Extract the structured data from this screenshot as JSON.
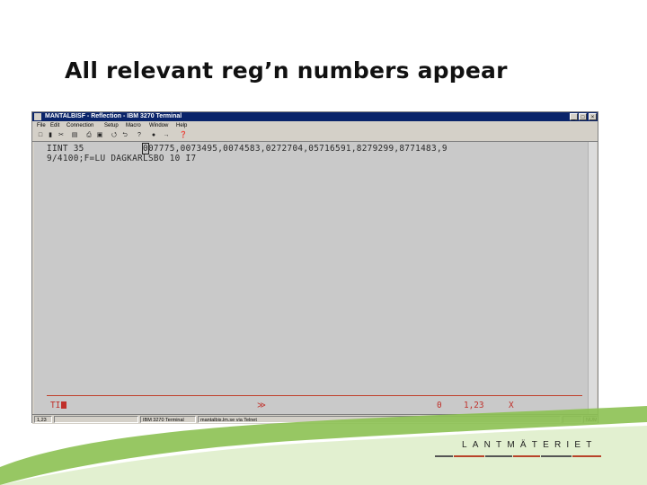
{
  "slide": {
    "title": "All relevant reg’n numbers appear"
  },
  "window": {
    "title": "MANTALBISF - Reflection - IBM 3270 Terminal",
    "controls": [
      "_",
      "□",
      "×"
    ]
  },
  "menu": [
    "File",
    "Edit",
    "Connection",
    "Setup",
    "Macro",
    "Window",
    "Help"
  ],
  "toolbar": [
    "□",
    "▮",
    "✂",
    "▤",
    "⎙",
    "▣",
    "⭯",
    "⮌",
    "?",
    "●",
    "→",
    "❓"
  ],
  "terminal": {
    "line1_prefix": "IINT 35           ",
    "line1_cursor": "0",
    "line1_rest": "07775,0073495,0074583,0272704,05716591,8279299,8771483,9",
    "line2": "9/4100;F=LU DAGKARLSBO 10 I7"
  },
  "status_line": {
    "field": "TI",
    "arrow": "≫",
    "count": "0",
    "position": "1,23",
    "mark": "X"
  },
  "statusbar": {
    "cursor": "1,23",
    "session": "IBM 3270 Terminal",
    "host": "mantalbis.lm.se via Telnet",
    "mode": "NUM"
  },
  "branding": {
    "logo_text": "LANTMÄTERIET"
  },
  "colors": {
    "titlebar": "#0a246a",
    "terminal_bg": "#c9c9c9",
    "status_red": "#c0302a",
    "accent_green": "#7ab648",
    "brand_red": "#b8432a"
  }
}
